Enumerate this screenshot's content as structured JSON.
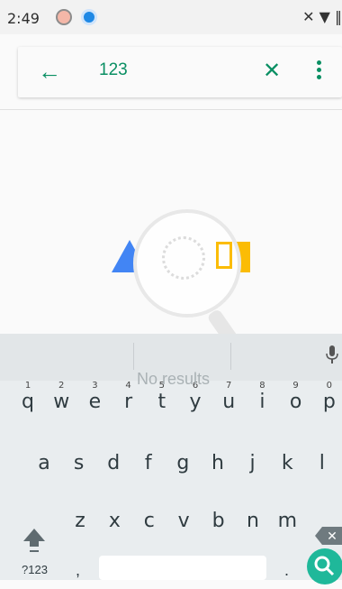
{
  "status": {
    "time": "2:49",
    "right_icons": "✕ ▼ ‖"
  },
  "search": {
    "value": "123"
  },
  "empty_state": {
    "message": "No results"
  },
  "keyboard": {
    "row1": [
      {
        "k": "q",
        "n": "1"
      },
      {
        "k": "w",
        "n": "2"
      },
      {
        "k": "e",
        "n": "3"
      },
      {
        "k": "r",
        "n": "4"
      },
      {
        "k": "t",
        "n": "5"
      },
      {
        "k": "y",
        "n": "6"
      },
      {
        "k": "u",
        "n": "7"
      },
      {
        "k": "i",
        "n": "8"
      },
      {
        "k": "o",
        "n": "9"
      },
      {
        "k": "p",
        "n": "0"
      }
    ],
    "row2": [
      "a",
      "s",
      "d",
      "f",
      "g",
      "h",
      "j",
      "k",
      "l"
    ],
    "row3": [
      "z",
      "x",
      "c",
      "v",
      "b",
      "n",
      "m"
    ],
    "symbols_label": "?123",
    "comma": ",",
    "period": "."
  },
  "colors": {
    "accent": "#0a8f63",
    "blue": "#4285f4",
    "yellow": "#fbbc05",
    "search_key": "#1fb89a"
  },
  "icons": [
    "back-icon",
    "close-icon",
    "more-vert-icon",
    "mic-icon",
    "shift-icon",
    "backspace-icon",
    "search-icon"
  ]
}
